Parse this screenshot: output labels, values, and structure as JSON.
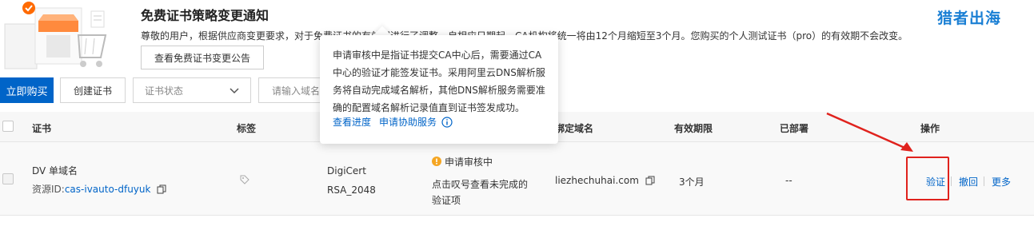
{
  "notice": {
    "title": "免费证书策略变更通知",
    "body": "尊敬的用户，根据供应商变更要求，对于免费证书的有效期进行了调整，自相应日期起，CA机构将统一将由12个月缩短至3个月。您购买的个人测试证书（pro）的有效期不会改变。",
    "button": "查看免费证书变更公告"
  },
  "watermark": "猎者出海",
  "toolbar": {
    "buy_label": "立即购买",
    "create_label": "创建证书",
    "status_placeholder": "证书状态",
    "search_placeholder": "请输入域名"
  },
  "table": {
    "headers": {
      "cert": "证书",
      "tag": "标签",
      "bound_domain": "绑定域名",
      "validity": "有效期限",
      "deployed": "已部署",
      "actions": "操作"
    },
    "row": {
      "cert_name": "DV 单域名",
      "resource_prefix": "资源ID:",
      "resource_id": "cas-ivauto-dfuyuk",
      "brand_line1": "DigiCert",
      "brand_line2": "RSA_2048",
      "status": "申请审核中",
      "status_hint_line1": "点击叹号查看未完成的",
      "status_hint_line2": "验证项",
      "domain": "liezhechuhai.com",
      "validity": "3个月",
      "deployed": "--",
      "action_verify": "验证",
      "action_revoke": "撤回",
      "action_more": "更多"
    }
  },
  "tooltip": {
    "text": "申请审核中是指证书提交CA中心后，需要通过CA中心的验证才能签发证书。采用阿里云DNS解析服务将自动完成域名解析，其他DNS解析服务需要准确的配置域名解析记录值直到证书签发成功。",
    "link_progress": "查看进度",
    "link_help": "申请协助服务"
  },
  "colors": {
    "primary": "#0064c8",
    "warning": "#f5a623",
    "annotation_red": "#e0221d",
    "watermark": "#1a7fd4"
  }
}
